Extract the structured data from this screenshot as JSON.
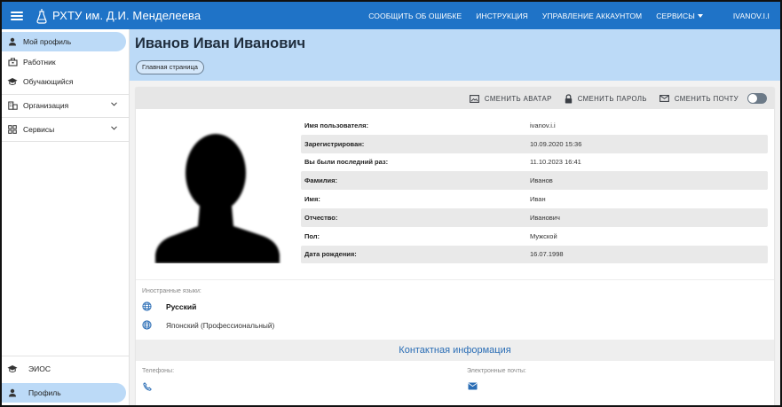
{
  "topbar": {
    "brand": "РХТУ им. Д.И. Менделеева",
    "nav": {
      "report_error": "Сообщить об ошибке",
      "instructions": "Инструкция",
      "account": "Управление аккаунтом",
      "services": "Сервисы",
      "user": "IVANOV.I.I"
    }
  },
  "sidebar": {
    "items": [
      {
        "label": "Мой профиль",
        "icon": "person-icon"
      },
      {
        "label": "Работник",
        "icon": "briefcase-icon"
      },
      {
        "label": "Обучающийся",
        "icon": "graduation-cap-icon"
      },
      {
        "label": "Организация",
        "icon": "building-icon"
      },
      {
        "label": "Сервисы",
        "icon": "apps-icon"
      }
    ],
    "bottom": [
      {
        "label": "ЭИОС",
        "icon": "graduation-cap-icon"
      },
      {
        "label": "Профиль",
        "icon": "person-icon"
      }
    ]
  },
  "header": {
    "title": "Иванов Иван Иванович",
    "home_chip": "Главная страница"
  },
  "toolbar": {
    "change_avatar": "Сменить аватар",
    "change_password": "Сменить пароль",
    "change_email": "Сменить почту"
  },
  "profile": [
    {
      "key": "Имя пользователя:",
      "value": "ivanov.i.i"
    },
    {
      "key": "Зарегистрирован:",
      "value": "10.09.2020 15:36"
    },
    {
      "key": "Вы были последний раз:",
      "value": "11.10.2023 16:41"
    },
    {
      "key": "Фамилия:",
      "value": "Иванов"
    },
    {
      "key": "Имя:",
      "value": "Иван"
    },
    {
      "key": "Отчество:",
      "value": "Иванович"
    },
    {
      "key": "Пол:",
      "value": "Мужской"
    },
    {
      "key": "Дата рождения:",
      "value": "16.07.1998"
    }
  ],
  "languages": {
    "caption": "Иностранные языки:",
    "items": [
      "Русский",
      "Японский (Профессиональный)"
    ]
  },
  "contacts": {
    "title": "Контактная информация",
    "phones_caption": "Телефоны:",
    "emails_caption": "Электронные почты:"
  },
  "colors": {
    "topbar": "#1f73c7",
    "header_band": "#bcdaf7",
    "accent_text": "#2a6db5"
  }
}
